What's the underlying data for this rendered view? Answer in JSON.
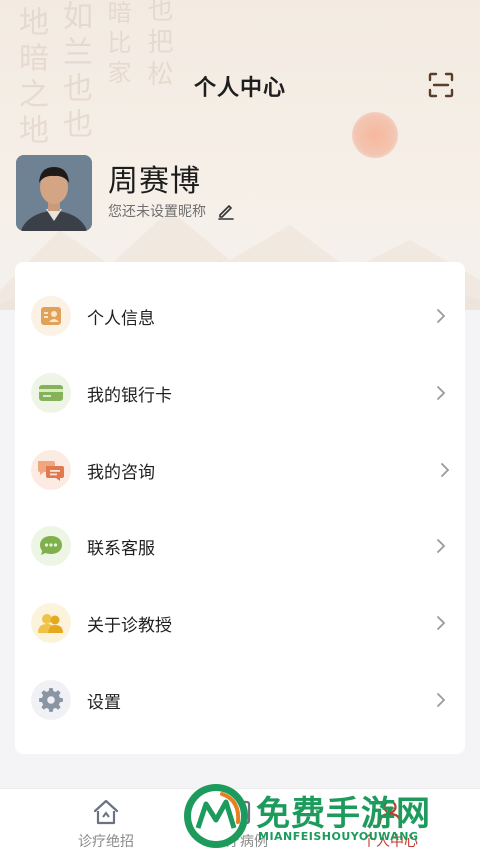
{
  "header": {
    "title": "个人中心",
    "scan_icon": "scan-icon"
  },
  "profile": {
    "name": "周赛博",
    "nickname_hint": "您还未设置昵称",
    "edit_icon": "pencil-icon"
  },
  "menu": {
    "items": [
      {
        "label": "个人信息",
        "icon": "id-card-icon",
        "icon_color": "#e0a25a",
        "bg_color": "#fbf1e4"
      },
      {
        "label": "我的银行卡",
        "icon": "bank-card-icon",
        "icon_color": "#86b35a",
        "bg_color": "#eef5e6"
      },
      {
        "label": "我的咨询",
        "icon": "chat-bubbles-icon",
        "icon_color": "#e07a4e",
        "bg_color": "#fbebe3"
      },
      {
        "label": "联系客服",
        "icon": "message-icon",
        "icon_color": "#7fb04c",
        "bg_color": "#edf5e5"
      },
      {
        "label": "关于诊教授",
        "icon": "users-icon",
        "icon_color": "#e6b02a",
        "bg_color": "#fbf3dc"
      },
      {
        "label": "设置",
        "icon": "gear-icon",
        "icon_color": "#8a94a3",
        "bg_color": "#eff1f4"
      }
    ]
  },
  "tabbar": {
    "tabs": [
      {
        "label": "诊疗绝招",
        "icon": "home-icon"
      },
      {
        "label": "诊疗病例",
        "icon": "case-icon"
      },
      {
        "label": "个人中心",
        "icon": "user-icon"
      }
    ]
  },
  "watermark": {
    "title": "免费手游网",
    "subtitle": "MIANFEISHOUYOUWANG"
  },
  "colors": {
    "accent": "#c0392b",
    "watermark_green": "#1d9b5c"
  }
}
